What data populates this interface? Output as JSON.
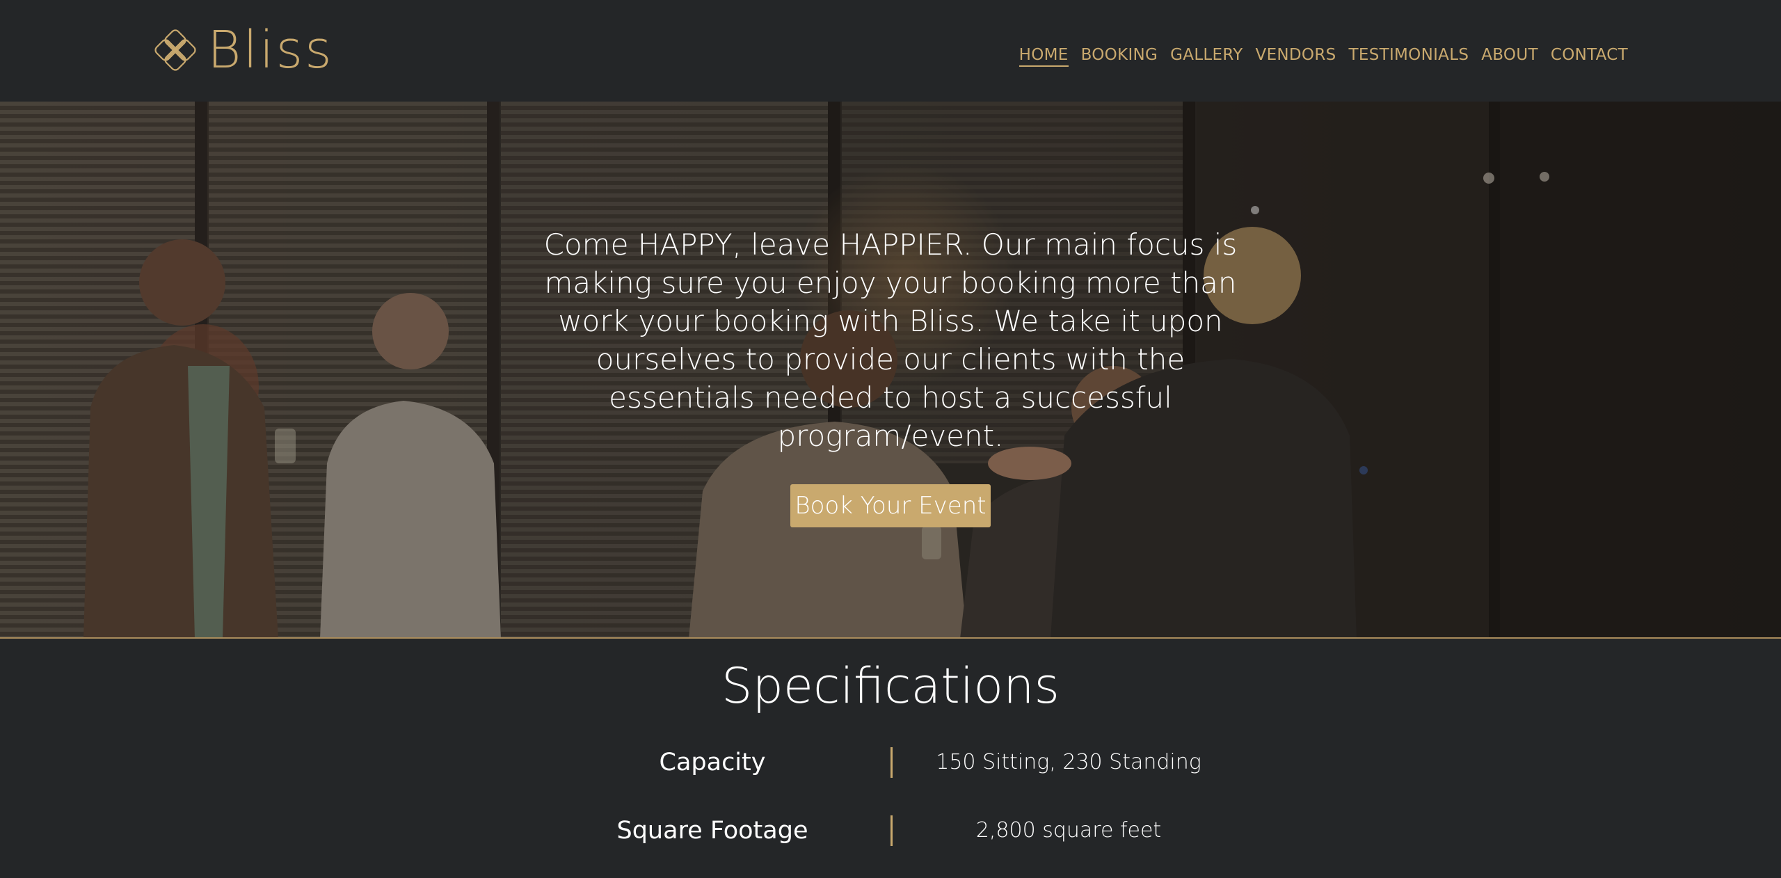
{
  "brand": {
    "name": "Bliss",
    "accent_color": "#c9a96e",
    "logo_icon": "lattice-knot-icon"
  },
  "nav": {
    "items": [
      {
        "label": "HOME",
        "active": true
      },
      {
        "label": "BOOKING"
      },
      {
        "label": "GALLERY"
      },
      {
        "label": "VENDORS"
      },
      {
        "label": "TESTIMONIALS"
      },
      {
        "label": "ABOUT"
      },
      {
        "label": "CONTACT"
      }
    ]
  },
  "hero": {
    "text_lines": [
      "Come HAPPY, leave HAPPIER. Our main focus is",
      "making sure you enjoy your booking more than",
      "work your booking with Bliss. We take it upon",
      "ourselves to provide our clients with the",
      "essentials needed to host a successful",
      "program/event."
    ],
    "button_label": "Book Your Event"
  },
  "specifications": {
    "title": "Specifications",
    "rows": [
      {
        "label": "Capacity",
        "value": "150 Sitting, 230 Standing"
      },
      {
        "label": "Square Footage",
        "value": "2,800 square feet"
      }
    ]
  },
  "colors": {
    "background": "#242628",
    "accent": "#c9a96e",
    "text": "#ffffff"
  }
}
